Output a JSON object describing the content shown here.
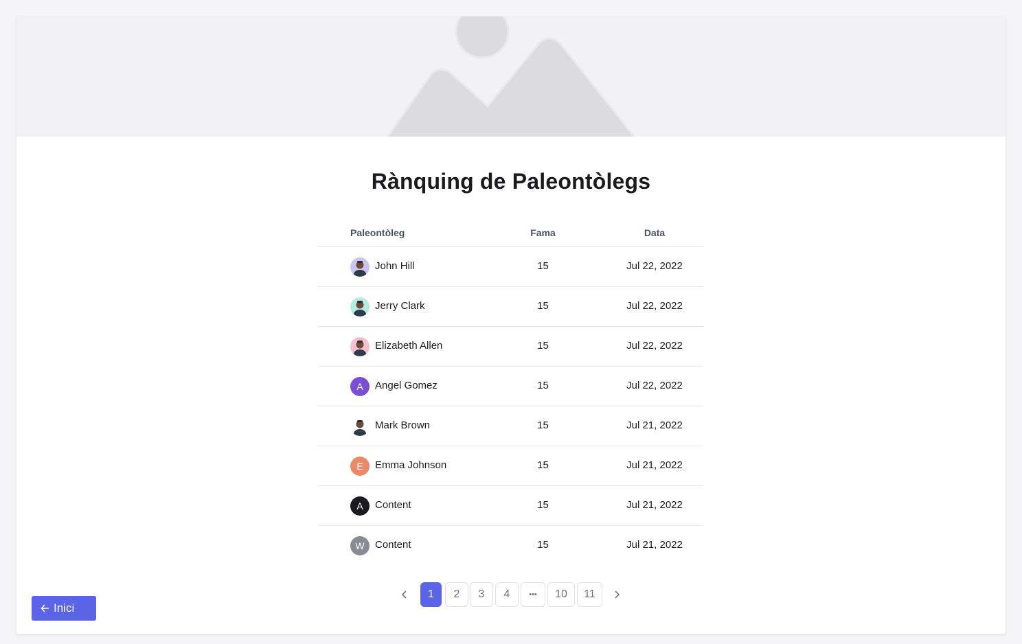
{
  "title": "Rànquing de Paleontòlegs",
  "table": {
    "columns": [
      "Paleontòleg",
      "Fama",
      "Data"
    ],
    "rows": [
      {
        "name": "John Hill",
        "fame": "15",
        "date": "Jul 22, 2022",
        "avatar": {
          "type": "photo",
          "bg": "#c8c6f0"
        }
      },
      {
        "name": "Jerry Clark",
        "fame": "15",
        "date": "Jul 22, 2022",
        "avatar": {
          "type": "photo",
          "bg": "#b9ece0"
        }
      },
      {
        "name": "Elizabeth Allen",
        "fame": "15",
        "date": "Jul 22, 2022",
        "avatar": {
          "type": "photo",
          "bg": "#f6c1cf"
        }
      },
      {
        "name": "Angel Gomez",
        "fame": "15",
        "date": "Jul 22, 2022",
        "avatar": {
          "type": "letter",
          "letter": "A",
          "bg": "#7a4fd6"
        }
      },
      {
        "name": "Mark Brown",
        "fame": "15",
        "date": "Jul 21, 2022",
        "avatar": {
          "type": "photo",
          "bg": "#ffffff"
        }
      },
      {
        "name": "Emma Johnson",
        "fame": "15",
        "date": "Jul 21, 2022",
        "avatar": {
          "type": "letter",
          "letter": "E",
          "bg": "#e88a67"
        }
      },
      {
        "name": "Content",
        "fame": "15",
        "date": "Jul 21, 2022",
        "avatar": {
          "type": "letter",
          "letter": "A",
          "bg": "#1b1b1f"
        }
      },
      {
        "name": "Content",
        "fame": "15",
        "date": "Jul 21, 2022",
        "avatar": {
          "type": "letter",
          "letter": "W",
          "bg": "#8a8a94"
        }
      }
    ]
  },
  "pagination": {
    "prev_icon": "chevron-left-icon",
    "next_icon": "chevron-right-icon",
    "pages": [
      "1",
      "2",
      "3",
      "4",
      "•••",
      "10",
      "11"
    ],
    "current": "1"
  },
  "back_button": {
    "label": "Inici",
    "icon": "arrow-left-icon"
  },
  "colors": {
    "accent": "#5b63e6",
    "hero_bg": "#f2f2f4",
    "hero_shape": "#dcdce0"
  }
}
